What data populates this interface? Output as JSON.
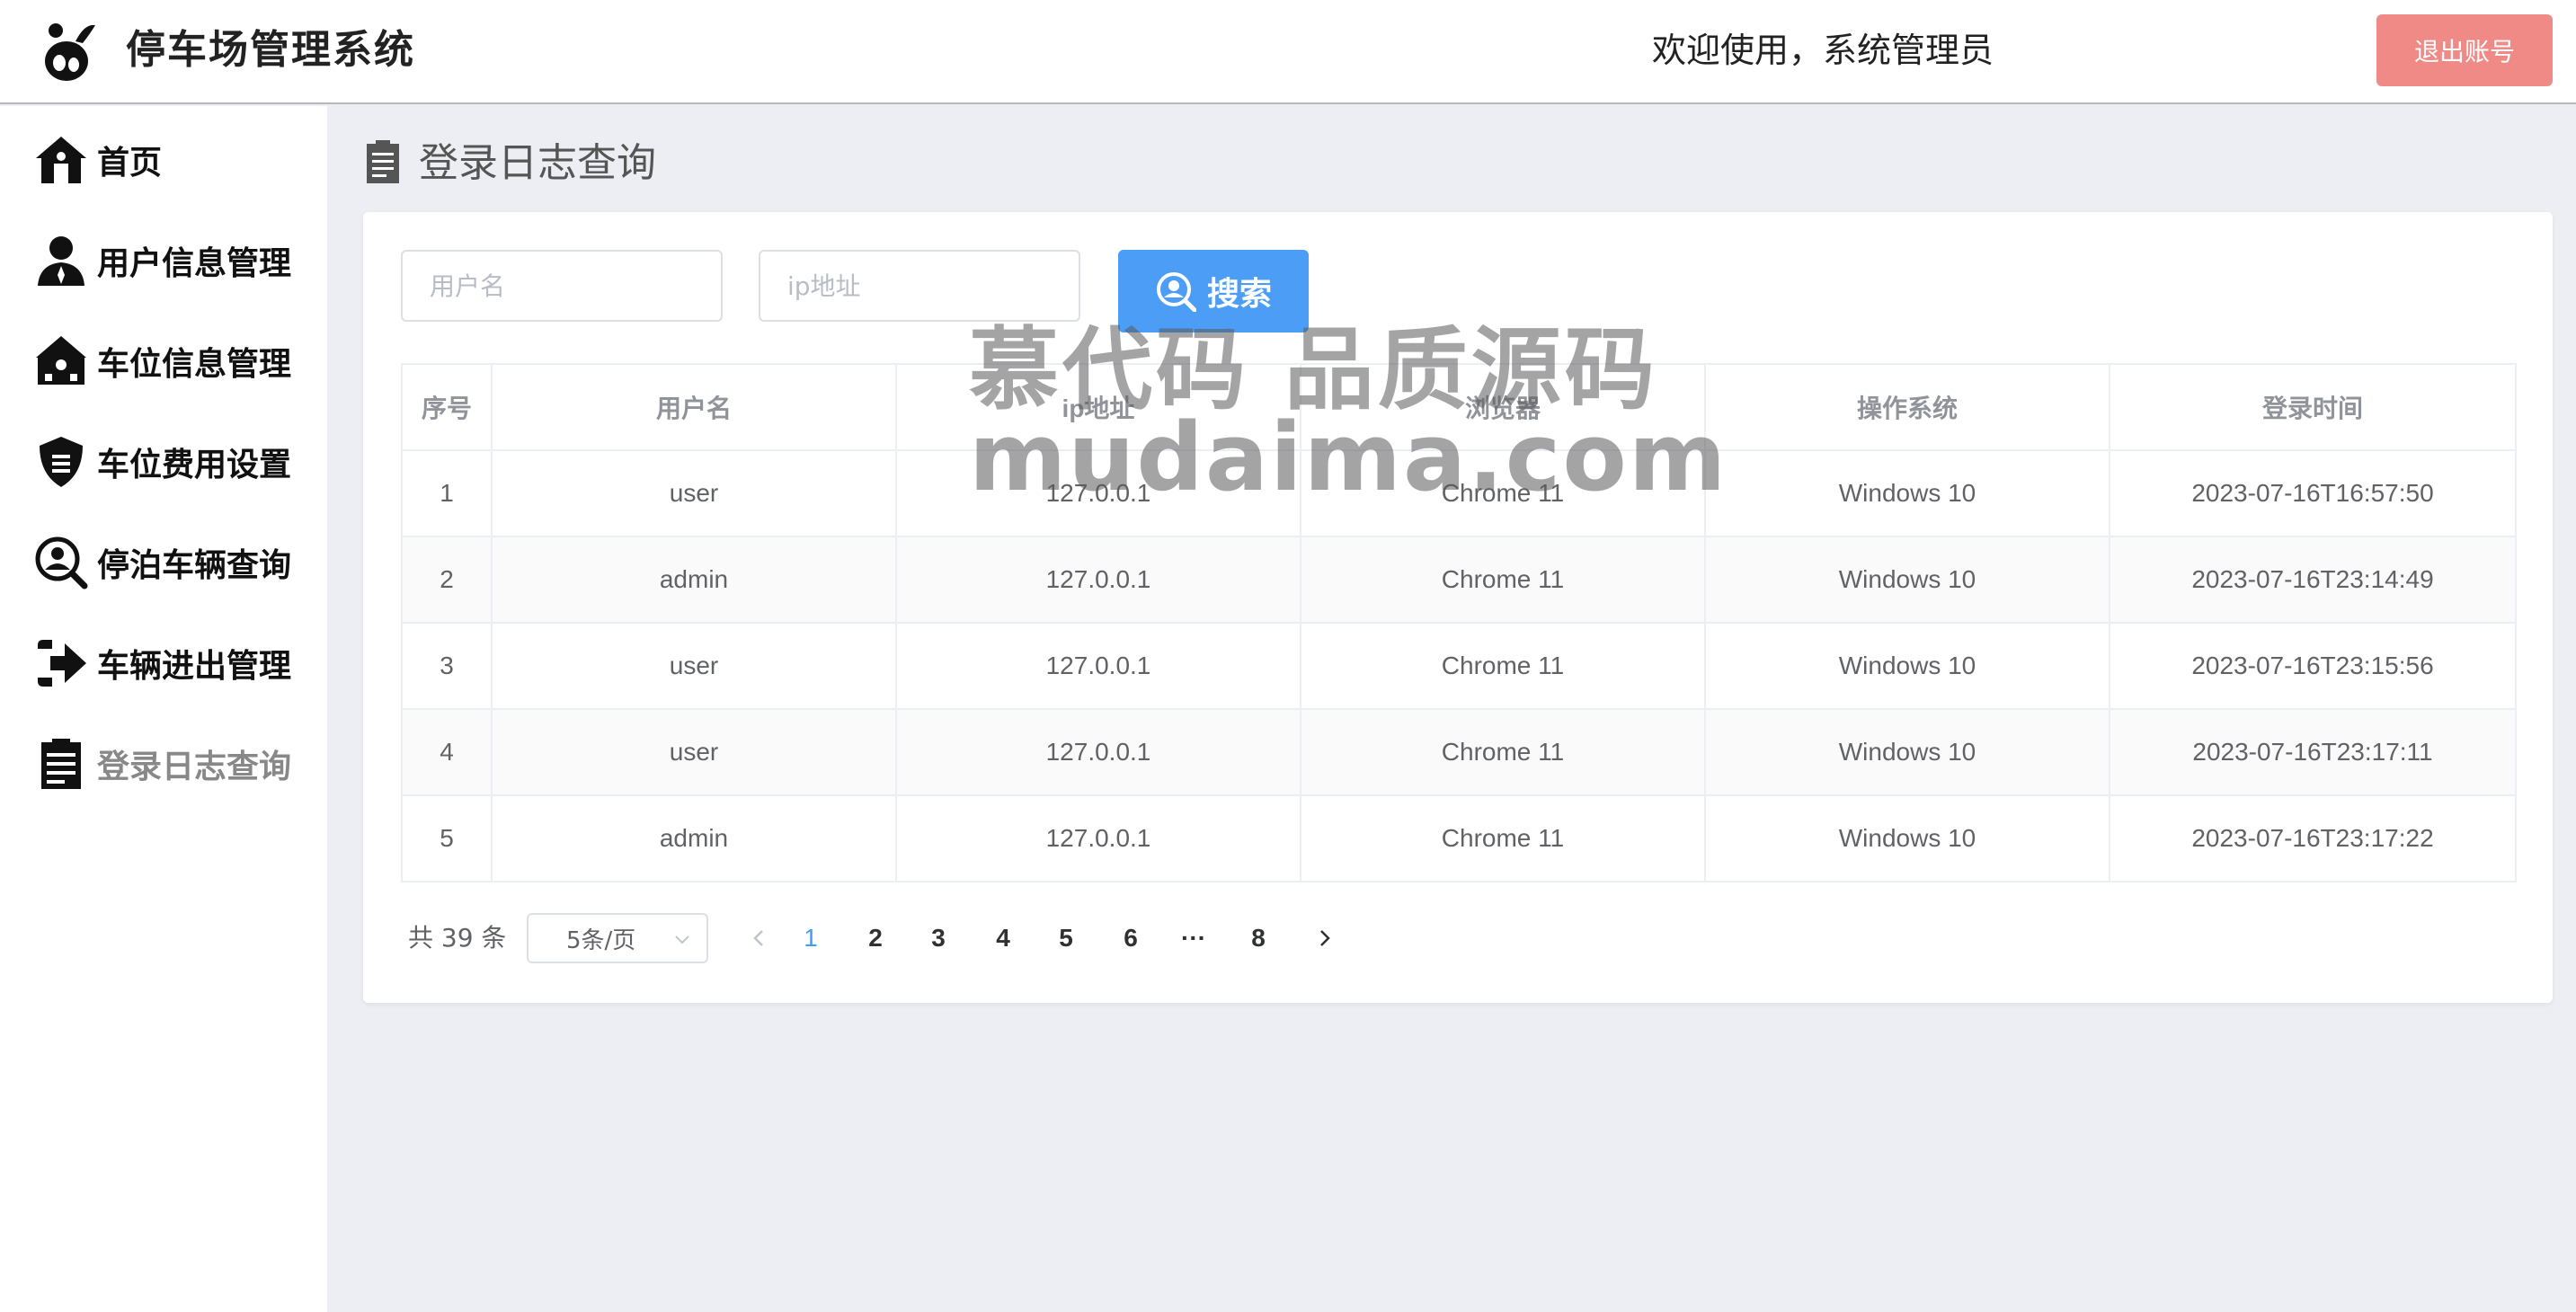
{
  "header": {
    "app_title": "停车场管理系统",
    "welcome": "欢迎使用，系统管理员",
    "logout_label": "退出账号"
  },
  "sidebar": {
    "items": [
      {
        "label": "首页",
        "icon": "home-icon"
      },
      {
        "label": "用户信息管理",
        "icon": "user-icon"
      },
      {
        "label": "车位信息管理",
        "icon": "building-icon"
      },
      {
        "label": "车位费用设置",
        "icon": "shield-icon"
      },
      {
        "label": "停泊车辆查询",
        "icon": "user-search-icon"
      },
      {
        "label": "车辆进出管理",
        "icon": "arrow-right-icon"
      },
      {
        "label": "登录日志查询",
        "icon": "clipboard-icon",
        "active": true
      }
    ]
  },
  "page": {
    "title": "登录日志查询"
  },
  "search": {
    "username_placeholder": "用户名",
    "ip_placeholder": "ip地址",
    "button_label": "搜索"
  },
  "table": {
    "headers": [
      "序号",
      "用户名",
      "ip地址",
      "浏览器",
      "操作系统",
      "登录时间"
    ],
    "rows": [
      [
        "1",
        "user",
        "127.0.0.1",
        "Chrome 11",
        "Windows 10",
        "2023-07-16T16:57:50"
      ],
      [
        "2",
        "admin",
        "127.0.0.1",
        "Chrome 11",
        "Windows 10",
        "2023-07-16T23:14:49"
      ],
      [
        "3",
        "user",
        "127.0.0.1",
        "Chrome 11",
        "Windows 10",
        "2023-07-16T23:15:56"
      ],
      [
        "4",
        "user",
        "127.0.0.1",
        "Chrome 11",
        "Windows 10",
        "2023-07-16T23:17:11"
      ],
      [
        "5",
        "admin",
        "127.0.0.1",
        "Chrome 11",
        "Windows 10",
        "2023-07-16T23:17:22"
      ]
    ]
  },
  "pagination": {
    "total_text": "共 39 条",
    "page_size": "5条/页",
    "pages": [
      "1",
      "2",
      "3",
      "4",
      "5",
      "6",
      "···",
      "8"
    ],
    "current": "1"
  },
  "watermark": {
    "line1": "慕代码 品质源码",
    "line2": "mudaima.com"
  },
  "colors": {
    "accent": "#409eff",
    "search_button": "#4c9df5",
    "logout_button": "#f08a86",
    "background": "#eceef3"
  }
}
